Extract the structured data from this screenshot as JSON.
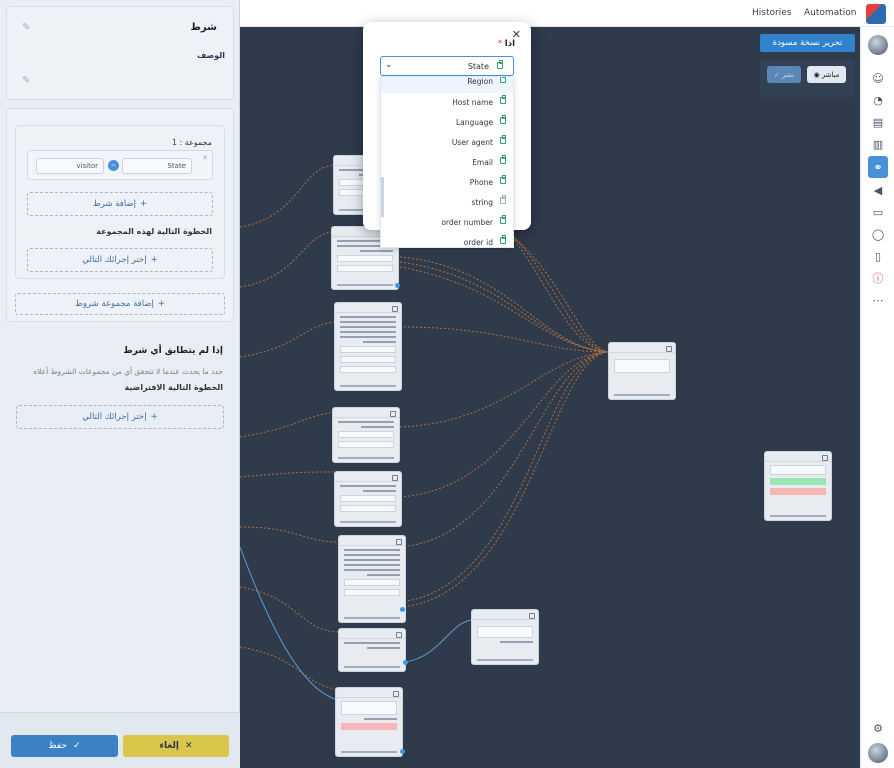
{
  "topbar": {
    "nav": [
      "Histories",
      "Automation"
    ]
  },
  "panel": {
    "title": "شرط",
    "description_label": "الوصف",
    "group_label": "مجموعة : 1",
    "condition": {
      "field": "State",
      "value": "visitor"
    },
    "add_condition": "إضافة شرط",
    "next_step_group": "الخطوة التالية لهذه المجموعة",
    "choose_next": "إختر إجرائك التالي",
    "add_group": "إضافة مجموعة شروط",
    "no_match_title": "إذا لم يتطابق أي شرط",
    "no_match_desc": "حدد ما يحدث عندما لا تتحقق أي من مجموعات الشروط أعلاه",
    "default_next": "الخطوة التالية الافتراضية",
    "choose_next_default": "إختر إجرائك التالي",
    "save": "حفظ",
    "cancel": "إلغاء"
  },
  "canvas": {
    "edit_draft": "تحرير نسخة مسودة",
    "live": "مباشر",
    "publish": "نشر"
  },
  "modal": {
    "label": "اذا",
    "required_mark": "*",
    "selected": "State",
    "options": [
      "Region",
      "Host name",
      "Language",
      "User agent",
      "Email",
      "Phone",
      "string",
      "order number",
      "order id"
    ]
  },
  "colors": {
    "accent": "#4a90d9",
    "save": "#3b82c4",
    "cancel": "#d9c64a",
    "canvas": "#2f3a4b",
    "edge_orange": "#c8783c",
    "edge_blue": "#5a9fd4"
  }
}
